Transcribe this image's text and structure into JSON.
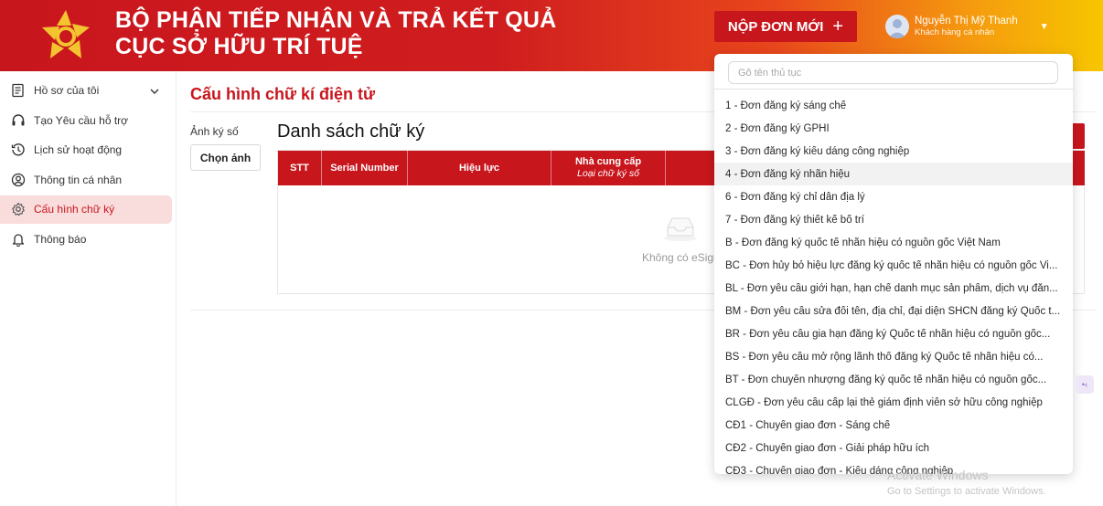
{
  "header": {
    "title_line1": "BỘ PHẬN TIẾP NHẬN VÀ TRẢ KẾT QUẢ",
    "title_line2": "CỤC SỞ HỮU TRÍ TUỆ",
    "new_button_label": "NỘP ĐƠN MỚI",
    "new_button_icon": "plus-icon",
    "user_name": "Nguyễn Thị Mỹ Thanh",
    "user_role": "Khách hàng cá nhân"
  },
  "colors": {
    "brand_red": "#c8161d",
    "brand_yellow": "#f7c600",
    "active_bg": "#f9dcdc"
  },
  "sidebar": {
    "items": [
      {
        "label": "Hồ sơ của tôi",
        "icon": "document-icon",
        "has_chevron": true
      },
      {
        "label": "Tạo Yêu cầu hỗ trợ",
        "icon": "headset-icon"
      },
      {
        "label": "Lịch sử hoạt động",
        "icon": "history-icon"
      },
      {
        "label": "Thông tin cá nhân",
        "icon": "user-icon"
      },
      {
        "label": "Cấu hình chữ ký",
        "icon": "gear-icon",
        "active": true
      },
      {
        "label": "Thông báo",
        "icon": "bell-icon"
      }
    ]
  },
  "main": {
    "title": "Cấu hình chữ kí điện tử",
    "image_label": "Ảnh ký số",
    "choose_image_button": "Chọn ảnh",
    "list_title": "Danh sách chữ ký",
    "table": {
      "columns": [
        {
          "label": "STT"
        },
        {
          "label": "Serial Number"
        },
        {
          "label": "Hiệu lực"
        },
        {
          "label": "Nhà cung cấp",
          "sub": "Loại chữ ký số"
        },
        {
          "label": ""
        }
      ],
      "empty_text": "Không có eSign"
    }
  },
  "dropdown": {
    "search_placeholder": "Gõ tên thủ tục",
    "items": [
      "1 - Đơn đăng ký sáng chế",
      "2 - Đơn đăng ký GPHI",
      "3 - Đơn đăng ký kiểu dáng công nghiệp",
      "4 - Đơn đăng ký nhãn hiệu",
      "6 - Đơn đăng ký chỉ dẫn địa lý",
      "7 - Đơn đăng ký thiết kế bố trí",
      "B - Đơn đăng ký quốc tế nhãn hiệu có nguồn gốc Việt Nam",
      "BC - Đơn hủy bỏ hiệu lực đăng ký quốc tế nhãn hiệu có nguồn gốc Vi...",
      "BL - Đơn yêu cầu giới hạn, hạn chế danh mục sản phẩm, dịch vụ đăn...",
      "BM - Đơn yêu cầu sửa đổi tên, địa chỉ, đại diện SHCN đăng ký Quốc t...",
      "BR - Đơn yêu cầu gia hạn đăng ký Quốc tế nhãn hiệu có nguồn gốc...",
      "BS - Đơn yêu cầu mở rộng lãnh thổ đăng ký Quốc tế nhãn hiệu có...",
      "BT - Đơn chuyển nhượng đăng ký quốc tế nhãn hiệu có nguồn gốc...",
      "CLGĐ - Đơn yêu cầu cấp lại thẻ giám định viên sở hữu công nghiệp",
      "CĐ1 - Chuyển giao đơn - Sáng chế",
      "CĐ2 - Chuyển giao đơn - Giải pháp hữu ích",
      "CĐ3 - Chuyển giao đơn - Kiểu dáng công nghiệp"
    ],
    "hovered_index": 3
  },
  "watermark": {
    "line1": "Activate Windows",
    "line2": "Go to Settings to activate Windows."
  }
}
